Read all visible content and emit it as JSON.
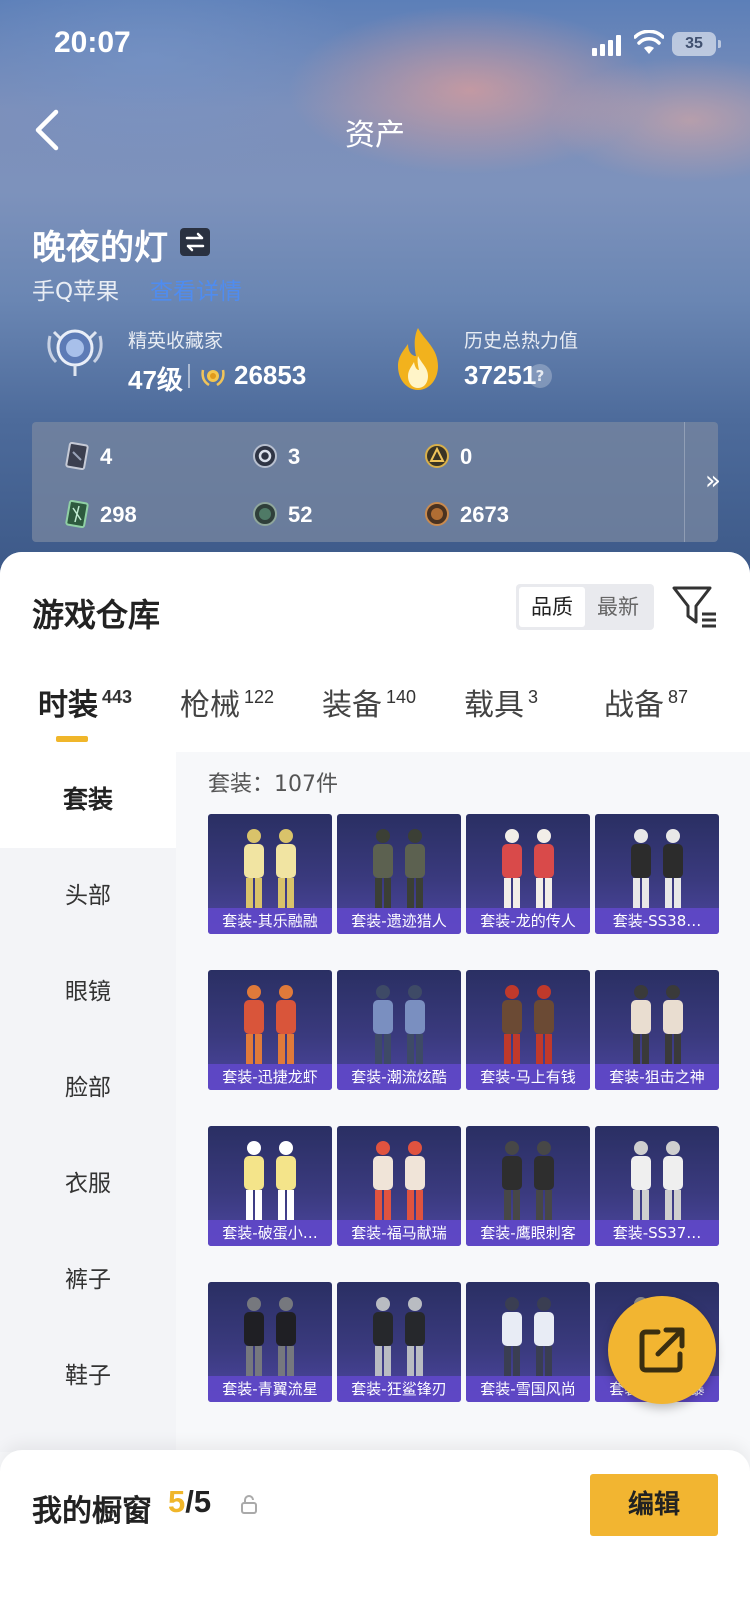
{
  "status_bar": {
    "time": "20:07",
    "battery": "35"
  },
  "header": {
    "title": "资产"
  },
  "player": {
    "name": "晚夜的灯",
    "platform": "手Q苹果",
    "platform_link": "查看详情"
  },
  "rank": {
    "caption": "精英收藏家",
    "level": "47级",
    "coins": "26853"
  },
  "heat": {
    "caption": "历史总热力值",
    "value": "37251",
    "help": "?"
  },
  "stats": [
    {
      "icon": "card-icon",
      "value": "4"
    },
    {
      "icon": "silver-medal-icon",
      "value": "3"
    },
    {
      "icon": "gold-medal-icon",
      "value": "0"
    },
    {
      "icon": "green-card-icon",
      "value": "298"
    },
    {
      "icon": "green-orb-icon",
      "value": "52"
    },
    {
      "icon": "bronze-orb-icon",
      "value": "2673"
    }
  ],
  "warehouse": {
    "title": "游戏仓库",
    "sort_options": [
      "品质",
      "最新"
    ],
    "tabs": [
      {
        "label": "时装",
        "count": "443"
      },
      {
        "label": "枪械",
        "count": "122"
      },
      {
        "label": "装备",
        "count": "140"
      },
      {
        "label": "载具",
        "count": "3"
      },
      {
        "label": "战备",
        "count": "87"
      }
    ],
    "categories": [
      "套装",
      "头部",
      "眼镜",
      "脸部",
      "衣服",
      "裤子",
      "鞋子"
    ],
    "count_label": "套装：107件",
    "items": [
      "套装-其乐融融",
      "套装-遗迹猎人",
      "套装-龙的传人",
      "套装-SS38…",
      "套装-迅捷龙虾",
      "套装-潮流炫酷",
      "套装-马上有钱",
      "套装-狙击之神",
      "套装-破蛋小…",
      "套装-福马献瑞",
      "套装-鹰眼刺客",
      "套装-SS37…",
      "套装-青翼流星",
      "套装-狂鲨锋刃",
      "套装-雪国风尚",
      "套装-街头风暴"
    ]
  },
  "showcase": {
    "label": "我的橱窗",
    "current": "5",
    "total": "/5",
    "edit_label": "编辑"
  },
  "colors": {
    "accent": "#f2b531",
    "card_bg": "#3a3a7e",
    "caption_bg": "#6048c8"
  }
}
